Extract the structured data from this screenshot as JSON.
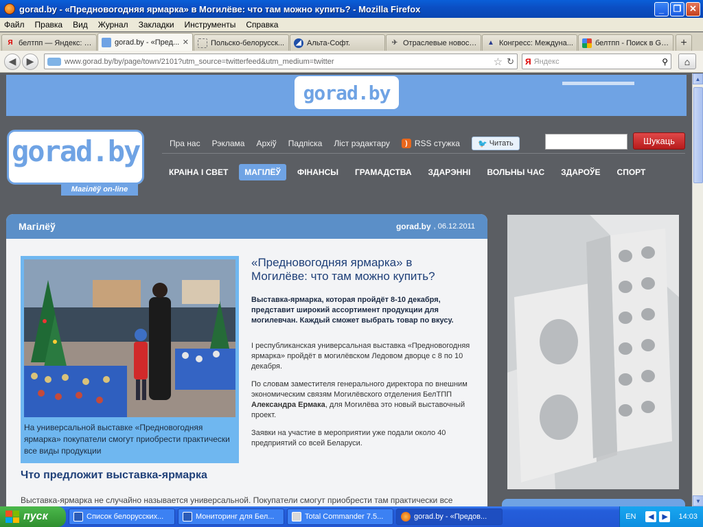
{
  "window": {
    "title": "gorad.by - «Предновогодняя ярмарка» в Могилёве: что там можно купить? - Mozilla Firefox"
  },
  "menu": [
    "Файл",
    "Правка",
    "Вид",
    "Журнал",
    "Закладки",
    "Инструменты",
    "Справка"
  ],
  "tabs": [
    {
      "label": "белтпп — Яндекс: Н...",
      "icon": "yandex-icon",
      "active": false
    },
    {
      "label": "gorad.by - «Пред...",
      "icon": "gorad-icon",
      "active": true
    },
    {
      "label": "Польско-белорусск...",
      "icon": "blank-page-icon",
      "active": false
    },
    {
      "label": "Альта-Софт.",
      "icon": "alta-icon",
      "active": false
    },
    {
      "label": "Отраслевые новост...",
      "icon": "news-icon",
      "active": false
    },
    {
      "label": "Конгресс: Междуна...",
      "icon": "congress-icon",
      "active": false
    },
    {
      "label": "белтпп - Поиск в Go...",
      "icon": "google-icon",
      "active": false
    }
  ],
  "nav": {
    "url": "www.gorad.by/by/page/town/2101?utm_source=twitterfeed&utm_medium=twitter",
    "search_engine": "Я",
    "search_placeholder": "Яндекс"
  },
  "site": {
    "logo_text": "gorad.by",
    "logo_tagline": "Магілёў on-line",
    "top_links": [
      "Пра нас",
      "Рэклама",
      "Архіў",
      "Падпіска",
      "Ліст рэдактару"
    ],
    "rss_label": "RSS стужка",
    "twitter_label": "Читать",
    "search_button": "Шукаць",
    "main_nav": [
      {
        "label": "КРАІНА І СВЕТ",
        "active": false
      },
      {
        "label": "МАГІЛЁЎ",
        "active": true
      },
      {
        "label": "ФІНАНСЫ",
        "active": false
      },
      {
        "label": "ГРАМАДСТВА",
        "active": false
      },
      {
        "label": "ЗДАРЭННІ",
        "active": false
      },
      {
        "label": "ВОЛЬНЫ ЧАС",
        "active": false
      },
      {
        "label": "ЗДАРОЎЕ",
        "active": false
      },
      {
        "label": "СПОРТ",
        "active": false
      }
    ]
  },
  "article": {
    "section": "Магілёў",
    "source": "gorad.by",
    "date": ", 06.12.2011",
    "headline": "«Предновогодняя ярмарка» в Могилёве: что там можно купить?",
    "lead": "Выставка-ярмарка, которая пройдёт 8-10 декабря, представит широкий ассортимент продукции для могилевчан. Каждый сможет выбрать товар по вкусу.",
    "p1": "I республиканская универсальная выставка «Предновогодняя ярмарка» пройдёт в могилёвском Ледовом дворце с 8 по 10 декабря.",
    "p2_before": "По словам заместителя генерального директора по внешним экономическим связям Могилёвского отделения БелТПП ",
    "p2_bold": "Александра Ермака",
    "p2_after": ", для Могилёва это новый выставочный проект.",
    "p3": "Заявки на участие в мероприятии уже подали около 40 предприятий со всей Беларуси.",
    "photo_caption": "На универсальной выставке «Предновогодняя ярмарка» покупатели смогут приобрести практически все виды продукции",
    "subhead": "Что предложит выставка-ярмарка",
    "body_tail": "Выставка-ярмарка не случайно называется универсальной. Покупатели смогут приобрести там практически все"
  },
  "taskbar": {
    "start_label": "пуск",
    "tasks": [
      {
        "label": "Список белорусских...",
        "active": false
      },
      {
        "label": "Мониторинг для Бел...",
        "active": false
      },
      {
        "label": "Total Commander 7.5...",
        "active": false
      },
      {
        "label": "gorad.by - «Предов...",
        "active": true
      }
    ],
    "lang": "EN",
    "time": "14:03"
  },
  "colors": {
    "accent": "#6fa3e4",
    "header_blue": "#5b8fc8",
    "search_red": "#c62828",
    "page_bg": "#5b5e63"
  }
}
